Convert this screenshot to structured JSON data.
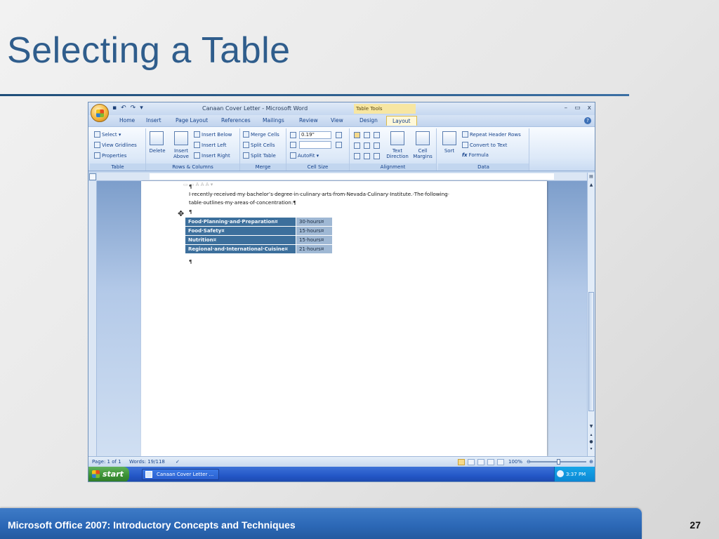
{
  "slide": {
    "title": "Selecting a Table",
    "footer": "Microsoft Office 2007: Introductory Concepts and Techniques",
    "page_number": "27"
  },
  "window": {
    "title": "Canaan Cover Letter - Microsoft Word",
    "context_tab_label": "Table Tools",
    "controls": [
      "–",
      "▭",
      "x"
    ]
  },
  "tabs": [
    "Home",
    "Insert",
    "Page Layout",
    "References",
    "Mailings",
    "Review",
    "View",
    "Design",
    "Layout"
  ],
  "active_tab": "Layout",
  "ribbon": {
    "groups": [
      "Table",
      "Rows & Columns",
      "Merge",
      "Cell Size",
      "Alignment",
      "Data"
    ],
    "table": {
      "select": "Select ▾",
      "view_gridlines": "View Gridlines",
      "properties": "Properties"
    },
    "rows_columns": {
      "delete": "Delete",
      "insert_above": "Insert Above",
      "insert_below": "Insert Below",
      "insert_left": "Insert Left",
      "insert_right": "Insert Right"
    },
    "merge": {
      "merge_cells": "Merge Cells",
      "split_cells": "Split Cells",
      "split_table": "Split Table"
    },
    "cell_size": {
      "height_value": "0.19\"",
      "autofit": "AutoFit ▾"
    },
    "alignment": {
      "text_direction": "Text Direction",
      "cell_margins": "Cell Margins"
    },
    "data": {
      "sort": "Sort",
      "repeat_header_rows": "Repeat Header Rows",
      "convert_to_text": "Convert to Text",
      "formula": "Formula"
    }
  },
  "document": {
    "paragraph_mark_1": "¶",
    "body_line_1": "I·recently·received·my·bachelor’s·degree·in·culinary·arts·from·Nevada·Culinary·Institute.·The·following·",
    "body_line_2": "table·outlines·my·areas·of·concentration:¶",
    "paragraph_mark_2": "¶",
    "paragraph_mark_3": "¶",
    "table_rows": [
      {
        "area": "Food·Planning·and·Preparation¤",
        "hours": "30·hours¤"
      },
      {
        "area": "Food·Safety¤",
        "hours": "15·hours¤"
      },
      {
        "area": "Nutrition¤",
        "hours": "15·hours¤"
      },
      {
        "area": "Regional·and·International·Cuisine¤",
        "hours": "21·hours¤"
      }
    ]
  },
  "status": {
    "page": "Page: 1 of 1",
    "words": "Words: 19/118",
    "zoom": "100%"
  },
  "taskbar": {
    "start": "start",
    "task_item": "Canaan Cover Letter ...",
    "clock": "3:37 PM"
  }
}
